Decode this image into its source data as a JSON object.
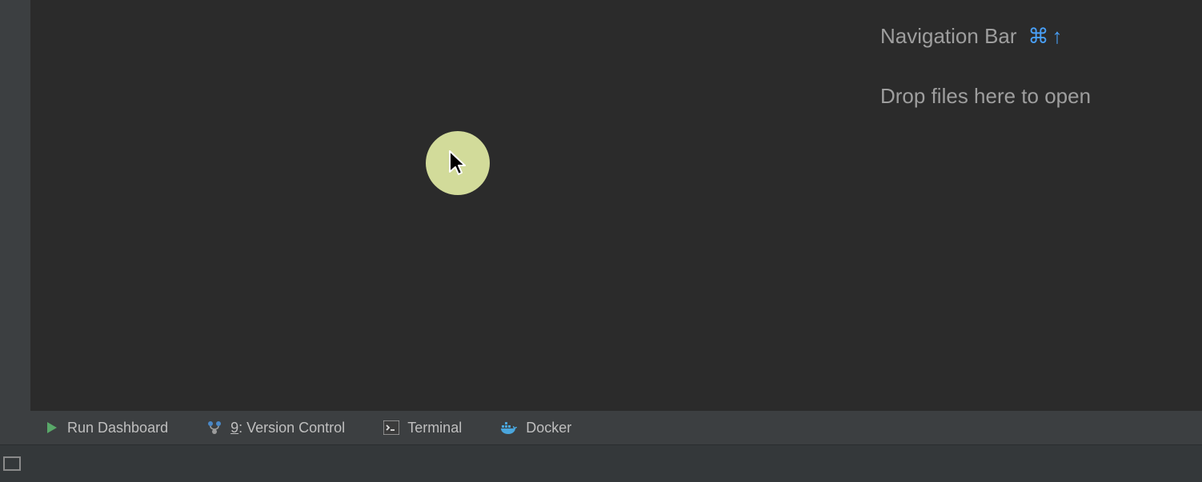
{
  "editor_hints": {
    "navigation_bar_label": "Navigation Bar",
    "navigation_bar_shortcut_cmd": "⌘",
    "navigation_bar_shortcut_arrow": "↑",
    "drop_files_label": "Drop files here to open"
  },
  "toolwindows": {
    "run_dashboard": "Run Dashboard",
    "version_control_prefix": "9",
    "version_control_label": ": Version Control",
    "terminal": "Terminal",
    "docker": "Docker"
  },
  "icons": {
    "run": "play-triangle",
    "vcs": "branch",
    "terminal": "terminal",
    "docker": "docker-whale",
    "status": "window-rect",
    "cursor": "arrow-pointer"
  }
}
